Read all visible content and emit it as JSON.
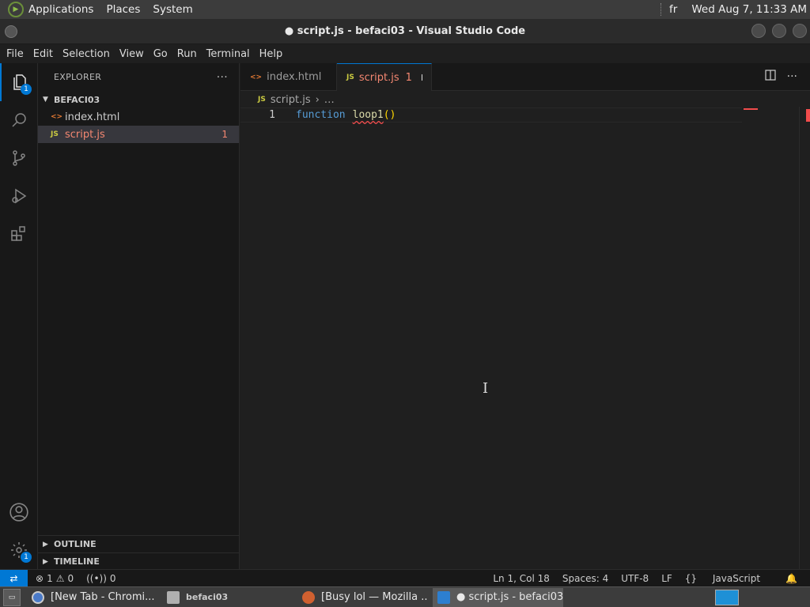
{
  "system_panel": {
    "menus": [
      "Applications",
      "Places",
      "System"
    ],
    "lang": "fr",
    "clock": "Wed Aug 7, 11:33 AM"
  },
  "window": {
    "title": "● script.js - befaci03 - Visual Studio Code"
  },
  "menubar": {
    "items": [
      "File",
      "Edit",
      "Selection",
      "View",
      "Go",
      "Run",
      "Terminal",
      "Help"
    ]
  },
  "activity_bar": {
    "explorer_badge": "1",
    "settings_badge": "1"
  },
  "sidebar": {
    "title": "EXPLORER",
    "more": "···",
    "folder": "BEFACI03",
    "files": [
      {
        "icon": "<>",
        "name": "index.html"
      },
      {
        "icon": "JS",
        "name": "script.js",
        "count": "1"
      }
    ],
    "outline": "OUTLINE",
    "timeline": "TIMELINE"
  },
  "tabs": [
    {
      "icon": "<>",
      "label": "index.html"
    },
    {
      "icon": "JS",
      "label": "script.js",
      "count": "1"
    }
  ],
  "breadcrumb": {
    "icon": "JS",
    "file": "script.js",
    "rest": "…"
  },
  "code": {
    "line_number": "1",
    "keyword": "function",
    "name": "loop1",
    "parens": "()"
  },
  "statusbar": {
    "errors": "1",
    "warnings": "0",
    "ports": "0",
    "position": "Ln 1, Col 18",
    "spaces": "Spaces: 4",
    "encoding": "UTF-8",
    "eol": "LF",
    "language": "JavaScript"
  },
  "taskbar": {
    "items": [
      "[New Tab - Chromi...",
      "befaci03",
      "[Busy lol — Mozilla ...",
      "● script.js - befaci03..."
    ]
  }
}
